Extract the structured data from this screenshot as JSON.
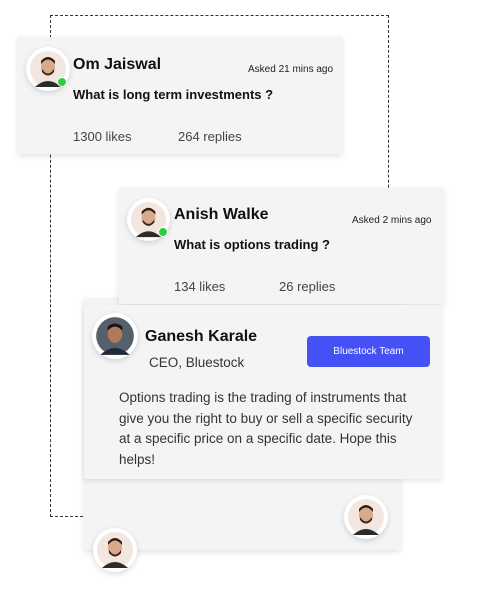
{
  "questions": [
    {
      "name": "Om Jaiswal",
      "asked": "Asked 21 mins ago",
      "question": "What is long term investments ?",
      "likes": "1300 likes",
      "replies": "264 replies"
    },
    {
      "name": "Anish Walke",
      "asked": "Asked 2 mins ago",
      "question": "What is options trading ?",
      "likes": "134 likes",
      "replies": "26 replies"
    }
  ],
  "answer": {
    "name": "Ganesh Karale",
    "role": "CEO, Bluestock",
    "badge": "Bluestock Team",
    "text": "Options trading is the trading of instruments that give you the right to buy or sell a specific security at a specific price on a specific date. Hope this helps!"
  },
  "colors": {
    "accent": "#4551f5",
    "online": "#2ecc40",
    "card": "#f4f4f4"
  }
}
